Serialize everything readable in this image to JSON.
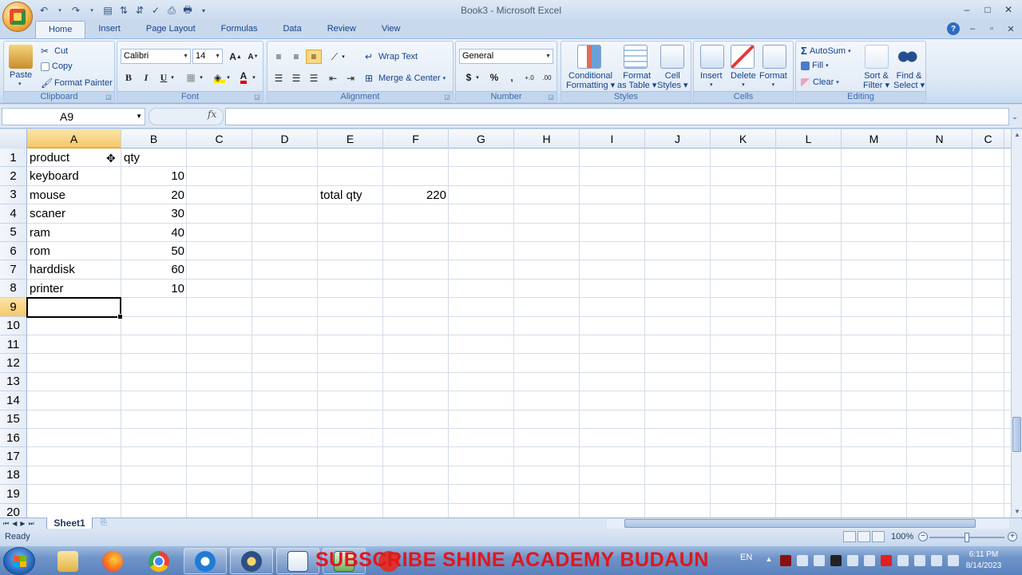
{
  "window": {
    "title": "Book3 - Microsoft Excel",
    "controls": [
      "–",
      "□",
      "✕"
    ]
  },
  "ribbon_tabs": [
    "Home",
    "Insert",
    "Page Layout",
    "Formulas",
    "Data",
    "Review",
    "View"
  ],
  "clipboard": {
    "paste": "Paste",
    "cut": "Cut",
    "copy": "Copy",
    "format_painter": "Format Painter",
    "label": "Clipboard"
  },
  "font": {
    "name": "Calibri",
    "size": "14",
    "bold": "B",
    "italic": "I",
    "underline": "U",
    "label": "Font"
  },
  "alignment": {
    "wrap_text": "Wrap Text",
    "merge_center": "Merge & Center",
    "label": "Alignment"
  },
  "number": {
    "format": "General",
    "currency": "$",
    "percent": "%",
    "comma": ",",
    "label": "Number"
  },
  "styles": {
    "conditional_1": "Conditional",
    "conditional_2": "Formatting",
    "format_table_1": "Format",
    "format_table_2": "as Table",
    "cell_styles_1": "Cell",
    "cell_styles_2": "Styles",
    "label": "Styles"
  },
  "cells_group": {
    "insert": "Insert",
    "delete": "Delete",
    "format": "Format",
    "label": "Cells"
  },
  "editing": {
    "autosum": "AutoSum",
    "fill": "Fill",
    "clear": "Clear",
    "sort_1": "Sort &",
    "sort_2": "Filter",
    "find_1": "Find &",
    "find_2": "Select",
    "label": "Editing"
  },
  "formula_bar": {
    "name_box": "A9",
    "fx": "fx",
    "value": ""
  },
  "columns": [
    "A",
    "B",
    "C",
    "D",
    "E",
    "F",
    "G",
    "H",
    "I",
    "J",
    "K",
    "L",
    "M",
    "N",
    "C"
  ],
  "rows": [
    "1",
    "2",
    "3",
    "4",
    "5",
    "6",
    "7",
    "8",
    "9",
    "10",
    "11",
    "12",
    "13",
    "14",
    "15",
    "16",
    "17",
    "18",
    "19",
    "20"
  ],
  "cells": {
    "A1": "product",
    "B1": "qty",
    "A2": "keyboard",
    "B2": "10",
    "A3": "mouse",
    "B3": "20",
    "A4": "scaner",
    "B4": "30",
    "A5": "ram",
    "B5": "40",
    "A6": "rom",
    "B6": "50",
    "A7": "harddisk",
    "B7": "60",
    "A8": "printer",
    "B8": "10",
    "E3": "total qty",
    "F3": "220"
  },
  "active_cell": "A9",
  "sheet_tabs": [
    "Sheet1"
  ],
  "status": {
    "ready": "Ready",
    "zoom": "100%",
    "zoom_percent": 100
  },
  "taskbar": {
    "banner": "SUBSCRIBE SHINE ACADEMY BUDAUN",
    "language": "EN",
    "time": "6:11 PM",
    "date": "8/14/2023"
  },
  "colors": {
    "selection_header": "#f5c86a",
    "banner": "#e3151c",
    "ribbon_text": "#15428b"
  }
}
